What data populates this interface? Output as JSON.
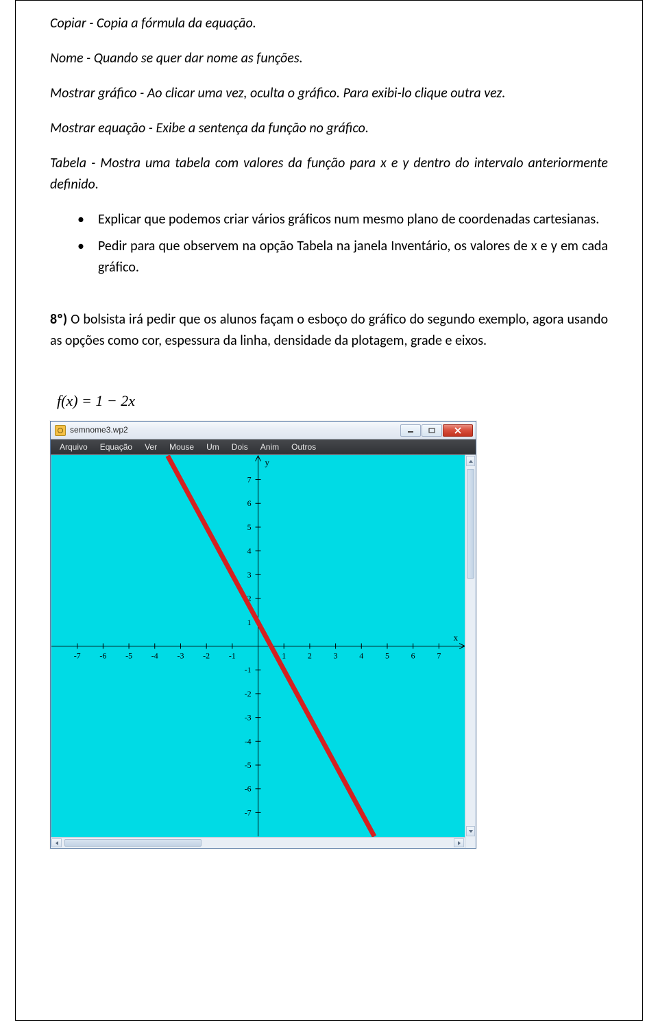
{
  "defs": {
    "copiar": {
      "term": "Copiar",
      "text": " - Copia a fórmula da equação."
    },
    "nome": {
      "term": "Nome",
      "text": " - Quando se quer dar nome as funções."
    },
    "mostrar_grafico": {
      "term": "Mostrar gráfico",
      "text": " - Ao clicar uma vez, oculta o gráfico. Para exibi-lo clique outra vez."
    },
    "mostrar_equacao": {
      "term": "Mostrar equação",
      "text": " - Exibe a sentença da função no gráfico."
    },
    "tabela": {
      "term": "Tabela",
      "text": " - Mostra uma tabela com valores da função para x e y dentro do intervalo anteriormente definido."
    }
  },
  "bullets": {
    "b1": "Explicar que podemos criar vários gráficos num mesmo plano de coordenadas cartesianas.",
    "b2": "Pedir para que observem na opção Tabela na janela Inventário, os valores de x e y em cada gráfico."
  },
  "step8": {
    "prefix": "8º)",
    "text": " O bolsista irá pedir que os alunos façam o esboço do gráfico do segundo exemplo, agora usando as opções como cor, espessura da linha, densidade da plotagem, grade e eixos."
  },
  "formula": "f(x) = 1 − 2x",
  "app": {
    "title": "semnome3.wp2",
    "menus": [
      "Arquivo",
      "Equação",
      "Ver",
      "Mouse",
      "Um",
      "Dois",
      "Anim",
      "Outros"
    ]
  },
  "chart_data": {
    "type": "line",
    "title": "",
    "xlabel": "x",
    "ylabel": "y",
    "xlim": [
      -8,
      8
    ],
    "ylim": [
      -8,
      8
    ],
    "x_ticks": [
      -7,
      -6,
      -5,
      -4,
      -3,
      -2,
      -1,
      1,
      2,
      3,
      4,
      5,
      6,
      7
    ],
    "y_ticks": [
      -7,
      -6,
      -5,
      -4,
      -3,
      -2,
      -1,
      1,
      2,
      3,
      4,
      5,
      6,
      7
    ],
    "series": [
      {
        "name": "f(x) = 1 - 2x",
        "color": "#d52020",
        "x": [
          -3.5,
          4.5
        ],
        "y": [
          8,
          -8
        ]
      }
    ]
  }
}
